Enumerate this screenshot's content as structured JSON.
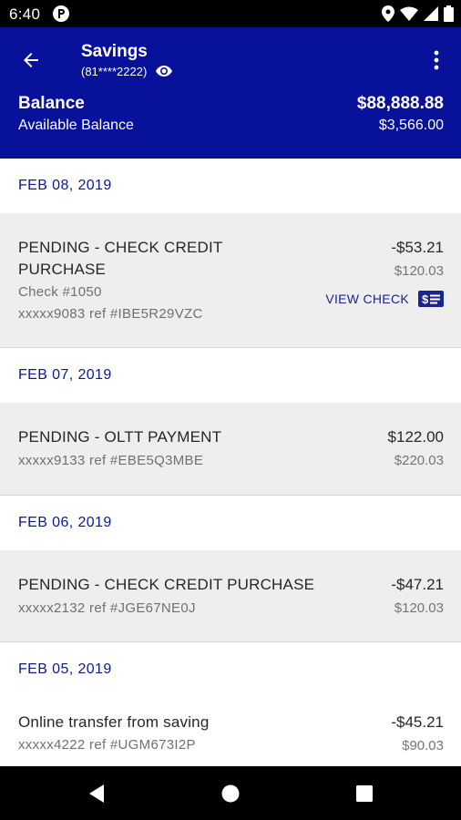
{
  "status_bar": {
    "time": "6:40"
  },
  "header": {
    "title": "Savings",
    "account_number": "(81****2222)",
    "balance_label": "Balance",
    "balance_value": "$88,888.88",
    "available_label": "Available Balance",
    "available_value": "$3,566.00"
  },
  "transactions": [
    {
      "date": "FEB 08, 2019",
      "desc_line1": "PENDING - CHECK CREDIT",
      "desc_line2": "PURCHASE",
      "check": "Check #1050",
      "ref": "xxxxx9083 ref #IBE5R29VZC",
      "amount": "-$53.21",
      "balance": "$120.03",
      "action": "VIEW CHECK"
    },
    {
      "date": "FEB 07, 2019",
      "desc": "PENDING - OLTT PAYMENT",
      "ref": "xxxxx9133 ref #EBE5Q3MBE",
      "amount": "$122.00",
      "balance": "$220.03"
    },
    {
      "date": "FEB 06, 2019",
      "desc": "PENDING - CHECK CREDIT PURCHASE",
      "ref": "xxxxx2132 ref #JGE67NE0J",
      "amount": "-$47.21",
      "balance": "$120.03"
    },
    {
      "date": "FEB 05, 2019",
      "desc": "Online transfer from saving",
      "ref": "xxxxx4222 ref #UGM673I2P",
      "amount": "-$45.21",
      "balance": "$90.03"
    }
  ],
  "icons": {
    "back": "arrow-back-icon",
    "eye": "eye-icon",
    "menu": "more-vert-icon",
    "check": "check-icon",
    "nav_back": "triangle-back-icon",
    "nav_home": "circle-home-icon",
    "nav_recents": "square-recents-icon"
  },
  "colors": {
    "header_bg": "#08119a",
    "date_text": "#0d1a8c",
    "row_bg": "#eeeeee",
    "accent": "#1a2491"
  }
}
